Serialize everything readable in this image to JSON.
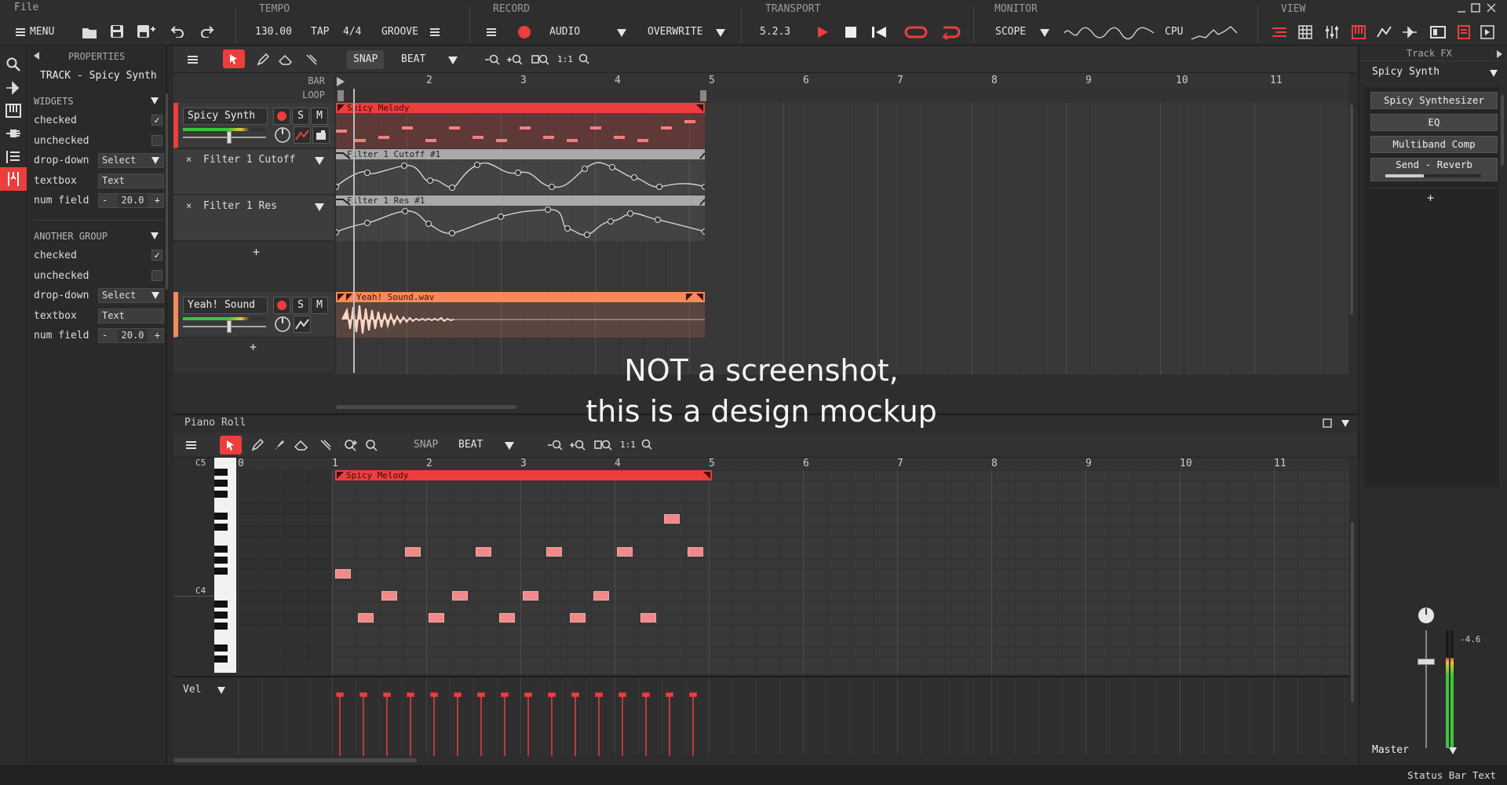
{
  "menu": {
    "file": "File"
  },
  "topbar": {
    "tempo": {
      "title": "TEMPO",
      "bpm": "130.00",
      "tap": "TAP",
      "sig": "4/4",
      "groove": "GROOVE"
    },
    "record": {
      "title": "RECORD",
      "mode": "AUDIO",
      "overwrite": "OVERWRITE"
    },
    "transport": {
      "title": "TRANSPORT",
      "position": "5.2.3"
    },
    "monitor": {
      "title": "MONITOR",
      "scope": "SCOPE",
      "cpu": "CPU"
    },
    "view": {
      "title": "VIEW"
    },
    "menu_label": "MENU"
  },
  "properties": {
    "title": "PROPERTIES",
    "track": "TRACK - Spicy Synth",
    "groups": [
      {
        "name": "WIDGETS",
        "checked": "checked",
        "unchecked": "unchecked",
        "dropdown": "drop-down",
        "dropdown_value": "Select",
        "textbox": "textbox",
        "textbox_value": "Text",
        "num": "num field",
        "num_value": "20.0"
      },
      {
        "name": "ANOTHER GROUP",
        "checked": "checked",
        "unchecked": "unchecked",
        "dropdown": "drop-down",
        "dropdown_value": "Select",
        "textbox": "textbox",
        "textbox_value": "Text",
        "num": "num field",
        "num_value": "20.0"
      }
    ]
  },
  "arrangement": {
    "snap": "SNAP",
    "beat": "BEAT",
    "ratio": "1:1",
    "bar_label": "BAR",
    "loop_label": "LOOP",
    "bars": [
      "2",
      "3",
      "4",
      "5",
      "6",
      "7",
      "8",
      "9",
      "10",
      "11"
    ],
    "tracks": [
      {
        "name": "Spicy Synth",
        "s": "S",
        "m": "M",
        "region": "Spicy Melody"
      },
      {
        "name": "Yeah! Sound",
        "s": "S",
        "m": "M",
        "region": "Yeah! Sound.wav"
      }
    ],
    "automation": [
      {
        "name": "Filter 1 Cutoff",
        "region": "Filter 1 Cutoff #1",
        "x": "×"
      },
      {
        "name": "Filter 1 Res",
        "region": "Filter 1 Res #1",
        "x": "×"
      }
    ],
    "plus": "+"
  },
  "watermark": {
    "line1": "NOT a screenshot,",
    "line2": "this is a design mockup"
  },
  "piano_roll": {
    "title": "Piano Roll",
    "snap": "SNAP",
    "beat": "BEAT",
    "ratio": "1:1",
    "bars": [
      "0",
      "1",
      "2",
      "3",
      "4",
      "5",
      "6",
      "7",
      "8",
      "9",
      "10",
      "11"
    ],
    "c5": "C5",
    "c4": "C4",
    "region": "Spicy Melody",
    "vel": "Vel"
  },
  "track_fx": {
    "title": "Track FX",
    "track": "Spicy Synth",
    "plugins": [
      "Spicy Synthesizer",
      "EQ",
      "Multiband Comp",
      "Send - Reverb"
    ],
    "plus": "+",
    "db": "-4.6",
    "master": "Master"
  },
  "status": {
    "text": "Status Bar Text"
  },
  "colors": {
    "accent": "#ee3d3d",
    "audio": "#f58a5c",
    "automation": "#a9a9a9"
  }
}
